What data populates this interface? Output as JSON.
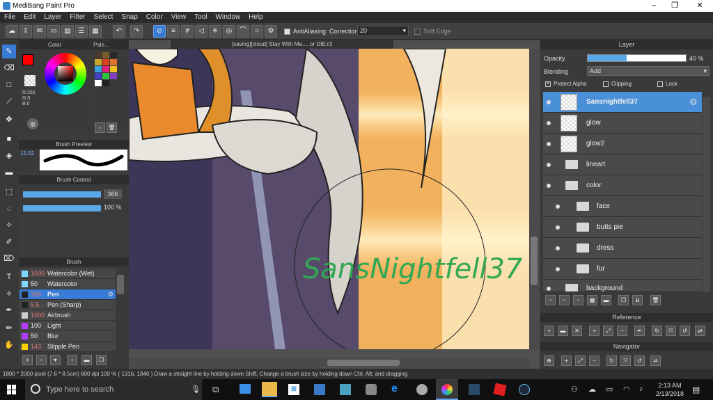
{
  "window": {
    "title": "MediBang Paint Pro",
    "minimize": "–",
    "restore": "❐",
    "close": "✕"
  },
  "menu": [
    "File",
    "Edit",
    "Layer",
    "Filter",
    "Select",
    "Snap",
    "Color",
    "View",
    "Tool",
    "Window",
    "Help"
  ],
  "toolbar": {
    "antialiasing_label": "AntiAliasing",
    "correction_label": "Correction",
    "correction_value": "20",
    "soft_edge_label": "Soft Edge"
  },
  "canvas_tab": "[saving][cloud] Stay With Me.... or DIE:r3",
  "color_panel": {
    "title": "Color",
    "r": "R:255",
    "g": "G:0",
    "b": "B:0",
    "primary": "#ff0000",
    "secondary": "#ffffff"
  },
  "palette_panel": {
    "title": "Pale..."
  },
  "brush_preview": {
    "title": "Brush Preview",
    "size": "15.52"
  },
  "brush_control": {
    "title": "Brush Control",
    "size_value": "366",
    "opacity_value": "100 %"
  },
  "brush_panel": {
    "title": "Brush",
    "items": [
      {
        "size": "1000",
        "name": "Watercolor (Wet)",
        "color": "#7fd8ff"
      },
      {
        "size": "50",
        "name": "Watercolor",
        "color": "#7fd8ff"
      },
      {
        "size": "366",
        "name": "Pen",
        "color": "#222222"
      },
      {
        "size": "5.5",
        "name": "Pen (Sharp)",
        "color": "#222222"
      },
      {
        "size": "1000",
        "name": "Airbrush",
        "color": "#cccccc"
      },
      {
        "size": "100",
        "name": "Light",
        "color": "#b23cff"
      },
      {
        "size": "50",
        "name": "Blur",
        "color": "#b23cff"
      },
      {
        "size": "143",
        "name": "Stipple Pen",
        "color": "#ffd000"
      }
    ]
  },
  "layer_panel": {
    "title": "Layer",
    "opacity_label": "Opacity",
    "opacity_value": "40 %",
    "opacity_fraction": 0.4,
    "blending_label": "Blending",
    "blending_value": "Add",
    "protect_alpha": "Protect Alpha",
    "clipping": "Clipping",
    "lock": "Lock",
    "layers": [
      {
        "name": "Sansnightfell37",
        "kind": "layer",
        "selected": true,
        "indent": 0
      },
      {
        "name": "glow",
        "kind": "layer",
        "selected": false,
        "indent": 0
      },
      {
        "name": "glow2",
        "kind": "layer",
        "selected": false,
        "indent": 0
      },
      {
        "name": "lineart",
        "kind": "folder",
        "selected": false,
        "indent": 0
      },
      {
        "name": "color",
        "kind": "folder",
        "selected": false,
        "indent": 0
      },
      {
        "name": "face",
        "kind": "folder",
        "selected": false,
        "indent": 1
      },
      {
        "name": "butts pie",
        "kind": "folder",
        "selected": false,
        "indent": 1
      },
      {
        "name": "dress",
        "kind": "folder",
        "selected": false,
        "indent": 1
      },
      {
        "name": "fur",
        "kind": "folder",
        "selected": false,
        "indent": 1
      },
      {
        "name": "background",
        "kind": "folder",
        "selected": false,
        "indent": 0
      }
    ]
  },
  "reference_panel": {
    "title": "Reference"
  },
  "navigator_panel": {
    "title": "Navigator"
  },
  "canvas_text": "SansNightfell37",
  "status": {
    "size": "1800 * 2000 pixel",
    "dims": "(7.6 * 8.5cm)",
    "dpi": "600 dpi",
    "zoom": "100 %",
    "coords": "( 1316, 1840 )",
    "hint": "Draw a straight line by holding down Shift, Change a brush size by holding down Ctrl, Alt, and dragging"
  },
  "taskbar": {
    "search_placeholder": "Type here to search",
    "time": "2:13 AM",
    "date": "2/13/2018"
  }
}
